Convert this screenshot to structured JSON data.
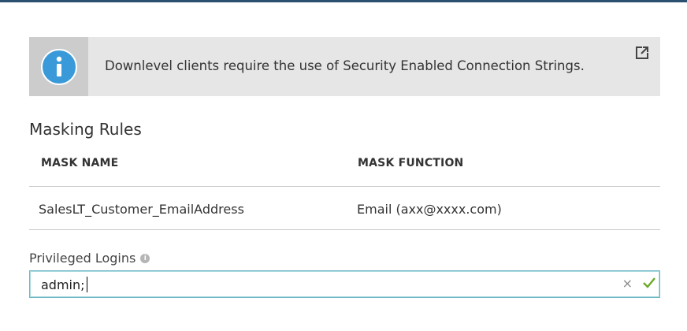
{
  "banner": {
    "icon": "info-icon",
    "message": "Downlevel clients require the use of Security Enabled Connection Strings.",
    "link_icon": "external-link-icon"
  },
  "masking_rules": {
    "title": "Masking Rules",
    "columns": [
      "MASK NAME",
      "MASK FUNCTION"
    ],
    "rows": [
      {
        "mask_name": "SalesLT_Customer_EmailAddress",
        "mask_function": "Email (axx@xxxx.com)"
      }
    ]
  },
  "privileged_logins": {
    "label": "Privileged Logins",
    "help_icon": "info-small-icon",
    "value": "admin;",
    "clear_icon": "clear-icon",
    "status_icon": "checkmark-icon"
  },
  "colors": {
    "top_bar": "#2b4f6e",
    "banner_bg": "#e6e6e6",
    "icon_bg": "#cccccc",
    "info_blue": "#3a9ad9",
    "input_border": "#6fb9c5",
    "valid_green": "#6aaa2a"
  }
}
